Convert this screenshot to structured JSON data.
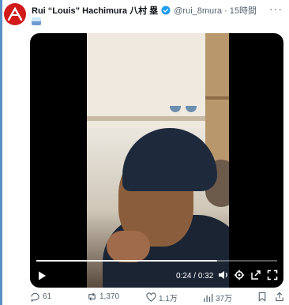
{
  "post": {
    "author_name": "Rui “Louis” Hachimura 八村 塁",
    "handle": "@rui_8mura",
    "separator": "·",
    "time_ago": "15時間",
    "more_label": "···",
    "text_emoji": "flag-emoji"
  },
  "video": {
    "current_time": "0:24",
    "duration": "0:32",
    "time_separator": " / ",
    "progress": 0.75,
    "controls": [
      "play-icon",
      "volume-icon",
      "settings-icon",
      "popout-icon",
      "fullscreen-icon"
    ]
  },
  "actions": {
    "replies": "61",
    "reposts": "1,370",
    "likes": "1.1万",
    "views": "37万"
  },
  "colors": {
    "avatar_bg": "#d11a1a",
    "verified": "#1d9bf0",
    "muted_text": "#536471"
  }
}
